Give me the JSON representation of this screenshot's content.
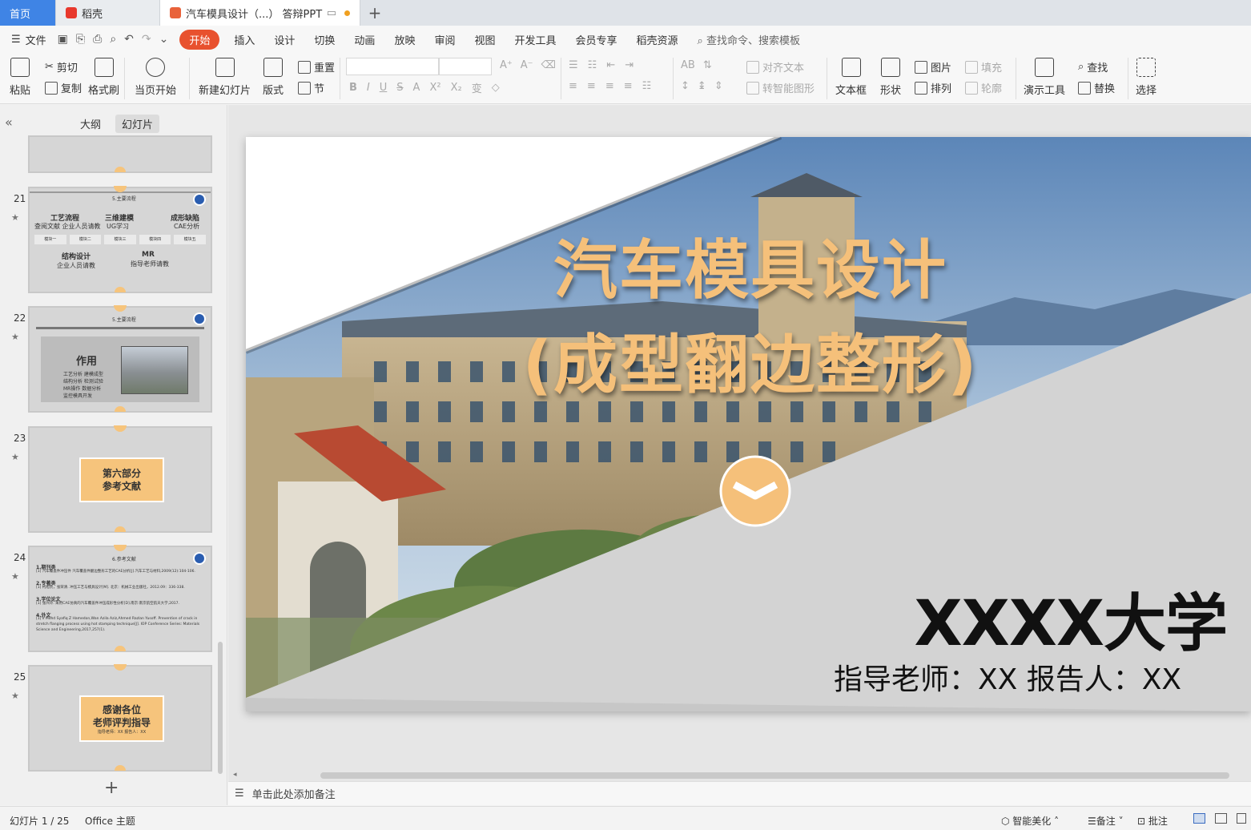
{
  "tabs": {
    "home": "首页",
    "daoke": "稻壳",
    "document": "汽车模具设计（...） 答辩PPT"
  },
  "menu": {
    "file": "文件",
    "items": [
      "开始",
      "插入",
      "设计",
      "切换",
      "动画",
      "放映",
      "审阅",
      "视图",
      "开发工具",
      "会员专享",
      "稻壳资源"
    ],
    "search_placeholder": "查找命令、搜索模板"
  },
  "ribbon": {
    "paste": "粘贴",
    "cut": "剪切",
    "copy": "复制",
    "format_painter": "格式刷",
    "from_current": "当页开始",
    "new_slide": "新建幻灯片",
    "layout": "版式",
    "reset": "重置",
    "section": "节",
    "align_text": "对齐文本",
    "smart_shape": "转智能图形",
    "textbox": "文本框",
    "shape": "形状",
    "picture": "图片",
    "arrange": "排列",
    "fill": "填充",
    "outline": "轮廓",
    "present_tools": "演示工具",
    "find": "查找",
    "replace": "替换",
    "select": "选择"
  },
  "left_panel": {
    "tab_outline": "大纲",
    "tab_slides": "幻灯片",
    "slides": [
      {
        "num": "21"
      },
      {
        "num": "22"
      },
      {
        "num": "23"
      },
      {
        "num": "24"
      },
      {
        "num": "25"
      }
    ],
    "slide21": {
      "title": "5.主要流程",
      "items": [
        {
          "h": "工艺流程",
          "t": "查阅文献 企业人员请教"
        },
        {
          "h": "三维建模",
          "t": "UG学习"
        },
        {
          "h": "成形缺陷",
          "t": "CAE分析"
        },
        {
          "h": "结构设计",
          "t": "企业人员请教"
        },
        {
          "h": "MR",
          "t": "指导老师请教"
        }
      ],
      "steps": [
        "模块一",
        "模块二",
        "模块三",
        "模块四",
        "模块五"
      ]
    },
    "slide22": {
      "title": "5.主要流程",
      "heading": "作用",
      "lines": [
        "工艺分析  建模成型",
        "结构分析  检测试验",
        "MR操作  数据分析",
        "监控模具开发"
      ]
    },
    "slide23": {
      "line1": "第六部分",
      "line2": "参考文献"
    },
    "slide24": {
      "title": "6.参考文献",
      "lines": [
        "1.期刊类",
        "[1] 汽车覆盖件冲压件 汽车覆盖件翻边整形工艺的CAE分析[J].汽车工艺与材料,2009(12):104-106.",
        "2.专著类",
        "[1] 柯旭贵，张荣清. 冲压工艺与模具设计[M]. 北京：机械工业出版社，2012.09：336-338.",
        "3.学位论文",
        "[1] 张兴玲. 采用CAE仿真的汽车覆盖件冲压成形性分析[D].南京:南京航空航天大学,2017.",
        "4.外文",
        "[1] Il Mohd Syafiq Z Hamedon,Wan Azila Aziz,Ahmed Razlan Yusoff. Prevention of crack in",
        "stretch flanging process using hot stamping technique[J]. IOP Conference Series: Materials",
        "Science and Engineering,2017,257(1)."
      ]
    },
    "slide25": {
      "line1": "感谢各位",
      "line2": "老师评判指导",
      "small": "指导老师：XX  报告人：XX"
    }
  },
  "slide": {
    "title_line1": "汽车模具设计",
    "title_line2": "(成型翻边整形)",
    "university": "XXXX大学",
    "subtitle": "指导老师：XX 报告人：XX"
  },
  "notes_placeholder": "单击此处添加备注",
  "status": {
    "slide_counter": "幻灯片 1 / 25",
    "theme": "Office 主题",
    "beautify": "智能美化",
    "notes": "备注",
    "comments": "批注"
  },
  "colors": {
    "accent_orange": "#e8512e",
    "title_gold": "#f5c07a",
    "home_tab_blue": "#3f84e5"
  }
}
